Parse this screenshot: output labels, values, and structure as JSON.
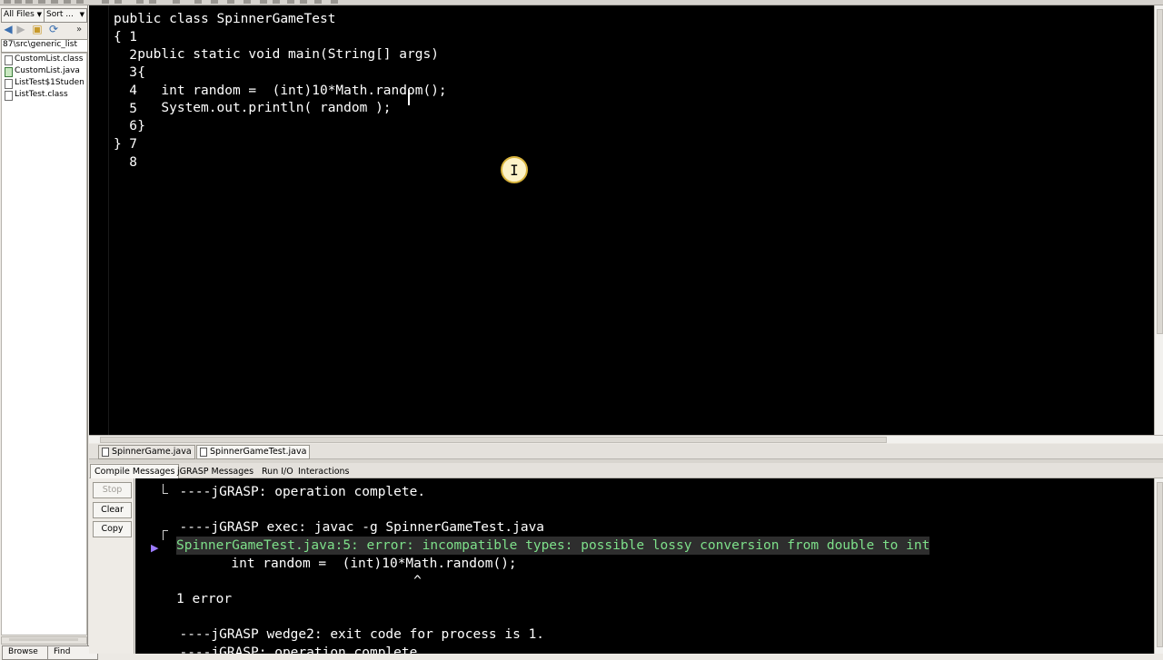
{
  "left_panel": {
    "filter_select": "All Files",
    "sort_select": "Sort ...",
    "path": "87\\src\\generic_list",
    "files": [
      {
        "name": "CustomList.class",
        "type": "class"
      },
      {
        "name": "CustomList.java",
        "type": "java"
      },
      {
        "name": "ListTest$1Studen",
        "type": "class"
      },
      {
        "name": "ListTest.class",
        "type": "class"
      }
    ],
    "browse_label": "Browse",
    "find_label": "Find"
  },
  "editor": {
    "lines": [
      {
        "num": "1",
        "text": "public class SpinnerGameTest"
      },
      {
        "num": "2",
        "text": "{"
      },
      {
        "num": "3",
        "text": "   public static void main(String[] args)"
      },
      {
        "num": "4",
        "text": "   {"
      },
      {
        "num": "5",
        "text": "      int random =  (int)10*Math.random();"
      },
      {
        "num": "6",
        "text": "      System.out.println( random );"
      },
      {
        "num": "7",
        "text": "   }"
      },
      {
        "num": "8",
        "text": "}"
      }
    ]
  },
  "file_tabs": [
    {
      "label": "SpinnerGame.java",
      "active": false
    },
    {
      "label": "SpinnerGameTest.java",
      "active": true
    }
  ],
  "message_tabs": [
    {
      "label": "Compile Messages",
      "active": true
    },
    {
      "label": "jGRASP Messages",
      "active": false
    },
    {
      "label": "Run I/O",
      "active": false
    },
    {
      "label": "Interactions",
      "active": false
    }
  ],
  "message_buttons": {
    "stop": "Stop",
    "clear": "Clear",
    "copy": "Copy"
  },
  "console": {
    "lines": [
      {
        "text": "  ----jGRASP: operation complete.",
        "error": false
      },
      {
        "text": "",
        "error": false
      },
      {
        "text": "  ----jGRASP exec: javac -g SpinnerGameTest.java",
        "error": false
      },
      {
        "text": "SpinnerGameTest.java:5: error: incompatible types: possible lossy conversion from double to int",
        "error": true
      },
      {
        "text": "      int random =  (int)10*Math.random();",
        "error": false
      },
      {
        "text": "                             ^",
        "error": false
      },
      {
        "text": "1 error",
        "error": false
      },
      {
        "text": "",
        "error": false
      },
      {
        "text": "  ----jGRASP wedge2: exit code for process is 1.",
        "error": false
      },
      {
        "text": "  ----jGRASP: operation complete.",
        "error": false
      }
    ]
  },
  "colors": {
    "editor_bg": "#000000",
    "code_text": "#ffffff",
    "error_text": "#7ee08a",
    "error_marker": "#9c7bff",
    "cursor_ring": "#d8b33c"
  }
}
